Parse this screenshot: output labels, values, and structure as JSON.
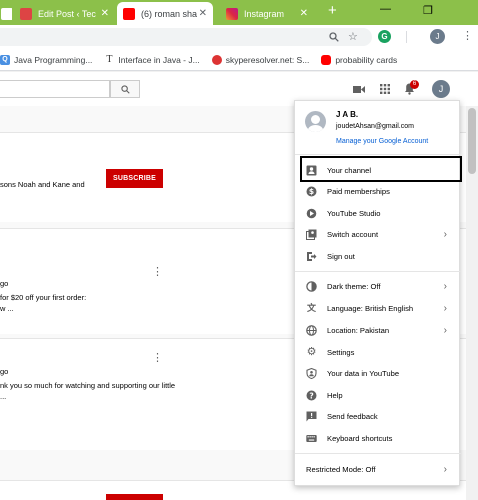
{
  "browser": {
    "tabs": [
      {
        "title": "Edit Post ‹ Tec",
        "close": "✕"
      },
      {
        "title": "(6) roman sha",
        "close": "✕"
      },
      {
        "title": "Instagram",
        "close": "✕"
      }
    ],
    "new_tab": "+",
    "profile_initial": "J",
    "extension_letter": "G"
  },
  "bookmarks": [
    {
      "label": "Java Programming...",
      "glyph": "Q"
    },
    {
      "label": "Interface in Java - J...",
      "glyph": "T"
    },
    {
      "label": "skyperesolver.net: S...",
      "glyph": ""
    },
    {
      "label": "probability cards",
      "glyph": ""
    }
  ],
  "bookmarks_more": "»",
  "youtube": {
    "search_placeholder": "",
    "notification_count": "6",
    "avatar_initial": "J"
  },
  "feed": {
    "card1_text": "sons Noah and Kane and",
    "subscribe_label": "SUBSCRIBE",
    "card2_line1": "go",
    "card2_line2": "for $20 off your first order:",
    "card2_line3": "w ...",
    "card3_line1": "go",
    "card3_line2": "nk you so much for watching and supporting our little",
    "card3_line3": "..."
  },
  "account_menu": {
    "name": "J A B.",
    "email": "joudetAhsan@gmail.com",
    "manage_link": "Manage your Google Account",
    "items": [
      {
        "label": "Your channel",
        "icon": "person-icon"
      },
      {
        "label": "Paid memberships",
        "icon": "dollar-icon"
      },
      {
        "label": "YouTube Studio",
        "icon": "gear-icon"
      },
      {
        "label": "Switch account",
        "icon": "switch-account-icon",
        "chevron": "›"
      },
      {
        "label": "Sign out",
        "icon": "sign-out-icon"
      },
      {
        "label": "Dark theme: Off",
        "icon": "dark-theme-icon",
        "chevron": "›"
      },
      {
        "label": "Language: British English",
        "icon": "translate-icon",
        "chevron": "›"
      },
      {
        "label": "Location: Pakistan",
        "icon": "globe-icon",
        "chevron": "›"
      },
      {
        "label": "Settings",
        "icon": "settings-icon"
      },
      {
        "label": "Your data in YouTube",
        "icon": "shield-person-icon"
      },
      {
        "label": "Help",
        "icon": "help-icon"
      },
      {
        "label": "Send feedback",
        "icon": "feedback-icon"
      },
      {
        "label": "Keyboard shortcuts",
        "icon": "keyboard-icon"
      }
    ],
    "restricted_mode": "Restricted Mode: Off",
    "restricted_chevron": "›"
  },
  "colors": {
    "chrome_frame": "#8cc04a",
    "youtube_red": "#cc0000",
    "link_blue": "#065fd4",
    "highlight_border": "#000000"
  }
}
